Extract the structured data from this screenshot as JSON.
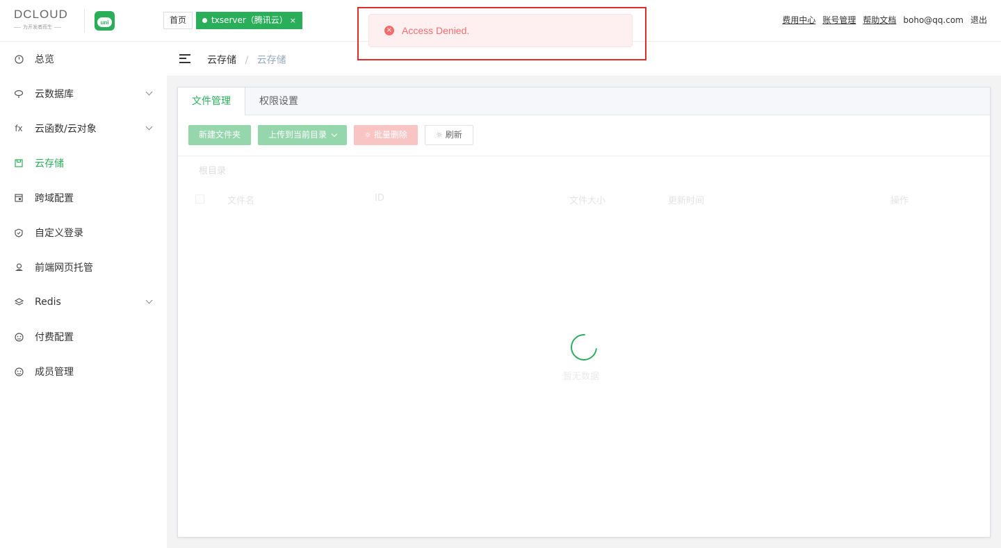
{
  "header": {
    "logo_text": "DCLOUD",
    "logo_sub": "为开发者而生",
    "uni_label": "uni",
    "tab_home": "首页",
    "tab_active": "txserver（腾讯云）",
    "tab_close": "×",
    "links": {
      "billing": "费用中心",
      "account": "账号管理",
      "help": "帮助文档",
      "user": "boho@qq.com",
      "logout": "退出"
    }
  },
  "sidebar": {
    "items": [
      {
        "label": "总览",
        "icon": "dashboard-icon"
      },
      {
        "label": "云数据库",
        "icon": "database-icon"
      },
      {
        "label": "云函数/云对象",
        "icon": "function-icon"
      },
      {
        "label": "云存储",
        "icon": "storage-icon"
      },
      {
        "label": "跨域配置",
        "icon": "cors-icon"
      },
      {
        "label": "自定义登录",
        "icon": "shield-icon"
      },
      {
        "label": "前端网页托管",
        "icon": "hosting-icon"
      },
      {
        "label": "Redis",
        "icon": "redis-icon"
      },
      {
        "label": "付费配置",
        "icon": "payment-icon"
      },
      {
        "label": "成员管理",
        "icon": "members-icon"
      }
    ],
    "fx_glyph": "fx"
  },
  "breadcrumb": {
    "parent": "云存储",
    "separator": "/",
    "current": "云存储"
  },
  "panel": {
    "tabs": [
      "文件管理",
      "权限设置"
    ],
    "toolbar": {
      "new_folder": "新建文件夹",
      "upload": "上传到当前目录",
      "batch_delete": "批量删除",
      "refresh": "刷新"
    },
    "root_dir": "根目录",
    "columns": {
      "name": "文件名",
      "id": "ID",
      "size": "文件大小",
      "updated": "更新时间",
      "actions": "操作"
    },
    "empty_text": "暂无数据"
  },
  "toast": {
    "message": "Access Denied.",
    "icon_glyph": "×"
  },
  "colors": {
    "primary": "#2bae5a",
    "error": "#f56c6c",
    "highlight": "#e02c2c"
  }
}
